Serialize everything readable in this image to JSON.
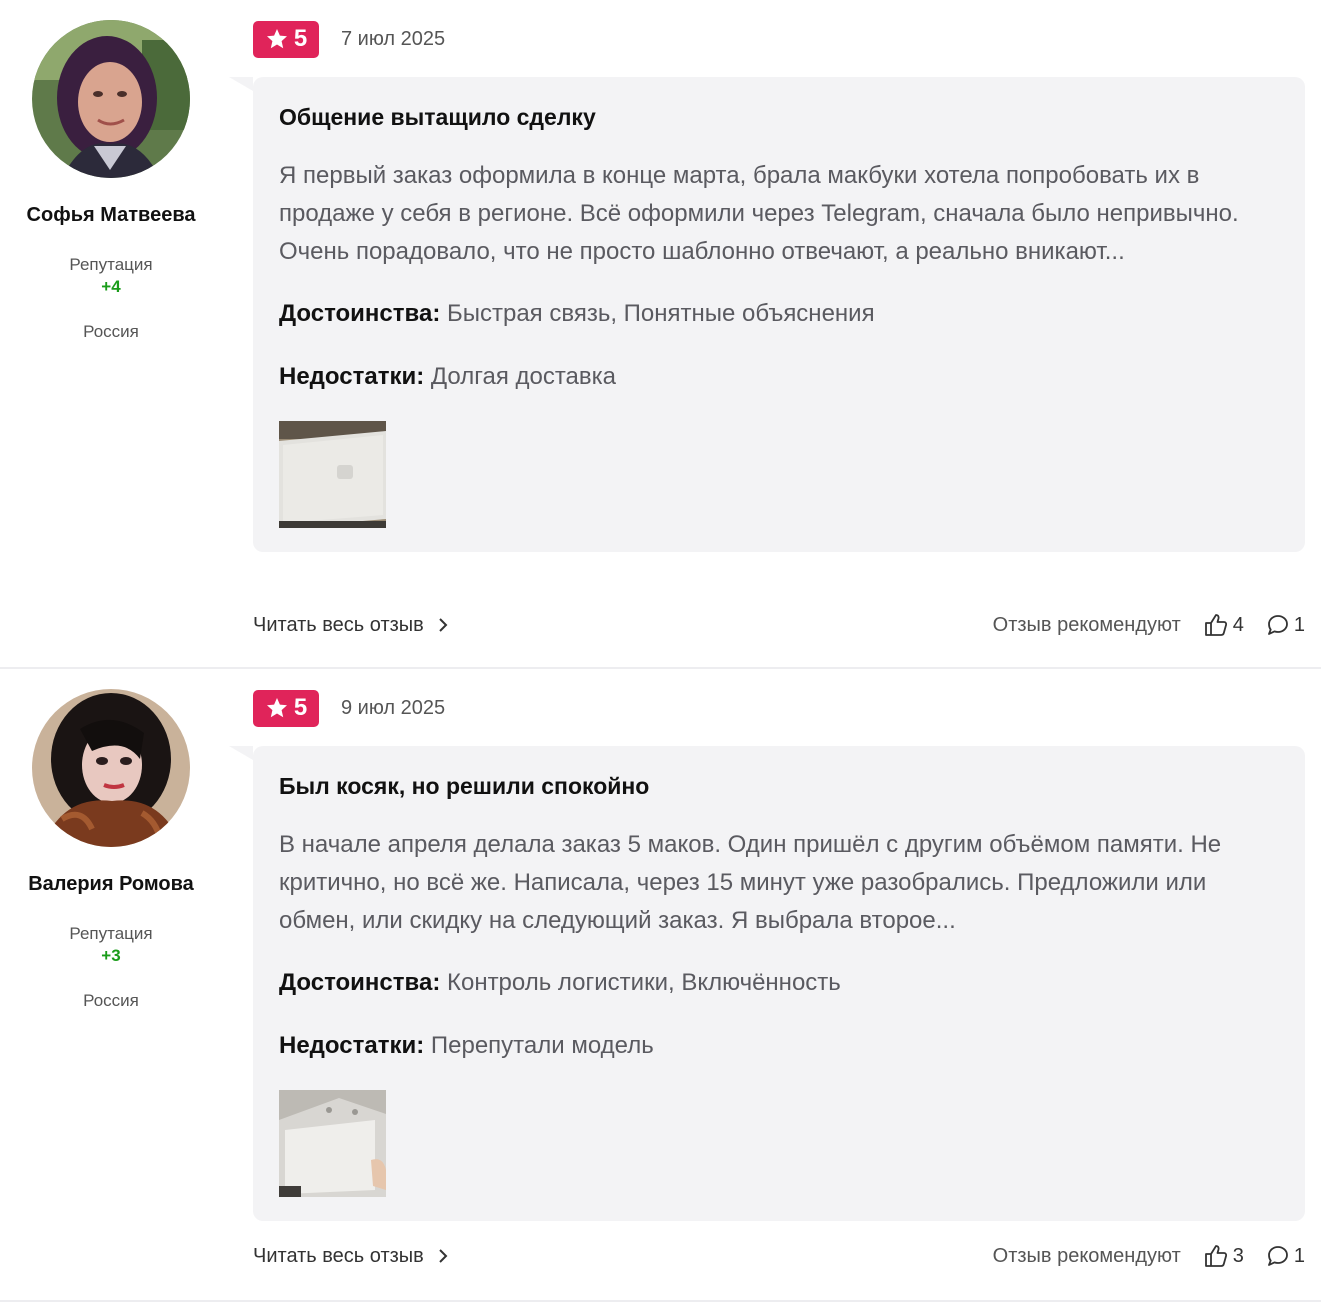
{
  "reviews": [
    {
      "author": {
        "name": "Софья Матвеева",
        "reputation_label": "Репутация",
        "reputation_value": "+4",
        "country": "Россия"
      },
      "rating": "5",
      "date": "7 июл 2025",
      "title": "Общение вытащило сделку",
      "text": "Я первый заказ оформила в конце марта, брала макбуки хотела попробовать их в продаже у себя в регионе. Всё оформили через Telegram, сначала было непривычно. Очень порадовало, что не просто шаблонно отвечают, а реально вникают...",
      "pros_label": "Достоинства:",
      "pros": "Быстрая связь, Понятные объяснения",
      "cons_label": "Недостатки:",
      "cons": "Долгая доставка",
      "read_more": "Читать весь отзыв",
      "recommend_label": "Отзыв рекомендуют",
      "likes": "4",
      "comments": "1"
    },
    {
      "author": {
        "name": "Валерия Ромова",
        "reputation_label": "Репутация",
        "reputation_value": "+3",
        "country": "Россия"
      },
      "rating": "5",
      "date": "9 июл 2025",
      "title": "Был косяк, но решили спокойно",
      "text": "В начале апреля делала заказ 5 маков. Один пришёл с другим объёмом памяти. Не критично, но всё же. Написала, через 15 минут уже разобрались. Предложили или обмен, или скидку на следующий заказ. Я выбрала второе...",
      "pros_label": "Достоинства:",
      "pros": "Контроль логистики, Включённость",
      "cons_label": "Недостатки:",
      "cons": "Перепутали модель",
      "read_more": "Читать весь отзыв",
      "recommend_label": "Отзыв рекомендуют",
      "likes": "3",
      "comments": "1"
    }
  ],
  "colors": {
    "rating_badge": "#e0245a",
    "reputation_positive": "#1a9c1a",
    "bubble_bg": "#f3f3f5"
  },
  "icons": [
    "star-icon",
    "chevron-right-icon",
    "thumbs-up-icon",
    "comment-icon"
  ]
}
